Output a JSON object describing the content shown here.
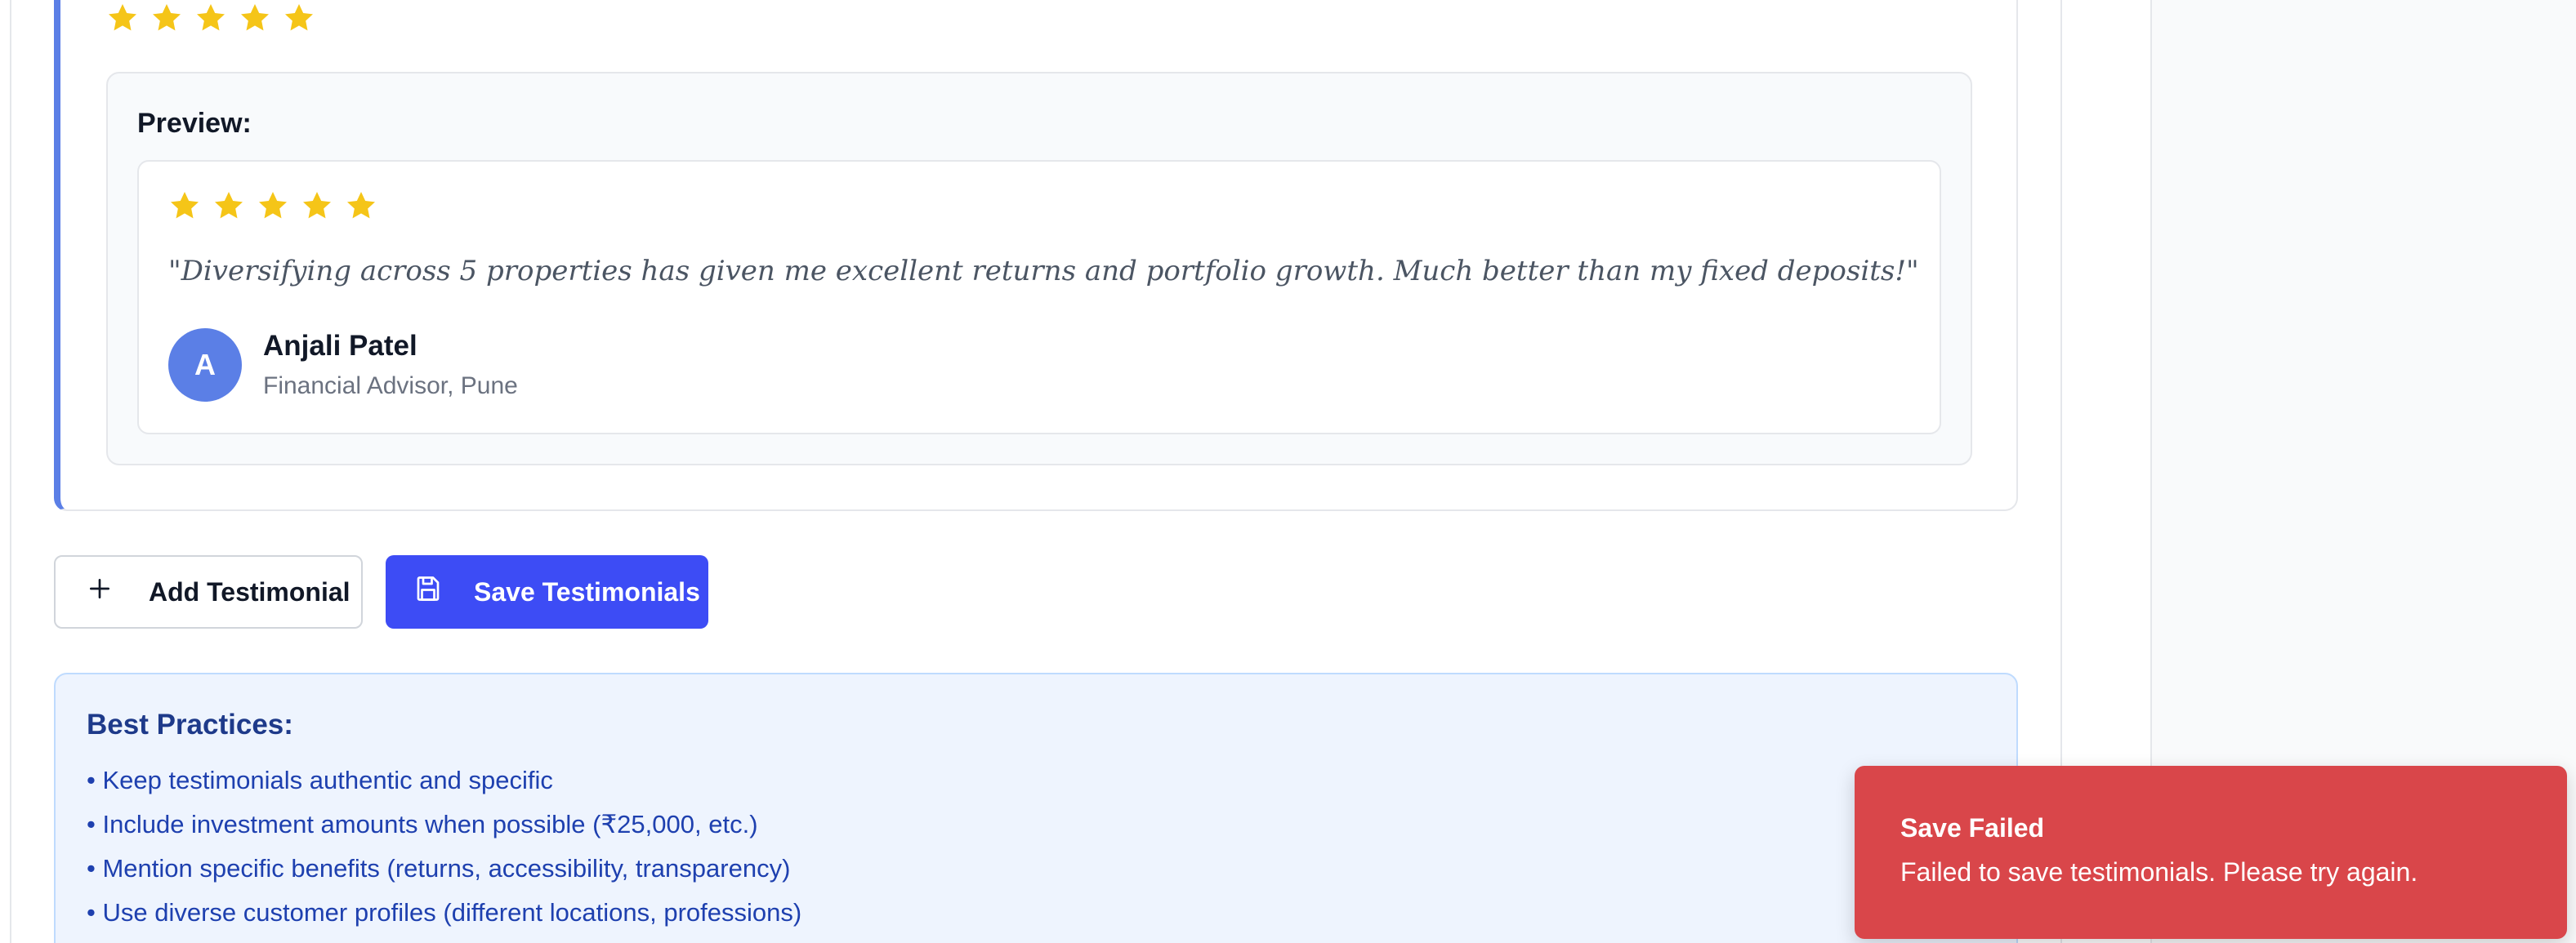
{
  "editor": {
    "rating": 5,
    "star_color": "#f5c518"
  },
  "preview": {
    "label": "Preview:",
    "rating": 5,
    "quote": "\"Diversifying across 5 properties has given me excellent returns and portfolio growth. Much better than my fixed deposits!\"",
    "avatar_initial": "A",
    "author_name": "Anjali Patel",
    "author_role": "Financial Advisor, Pune"
  },
  "actions": {
    "add_label": "Add Testimonial",
    "save_label": "Save Testimonials",
    "add_icon": "plus-icon",
    "save_icon": "save-icon"
  },
  "best_practices": {
    "title": "Best Practices:",
    "items": [
      "• Keep testimonials authentic and specific",
      "• Include investment amounts when possible (₹25,000, etc.)",
      "• Mention specific benefits (returns, accessibility, transparency)",
      "• Use diverse customer profiles (different locations, professions)"
    ]
  },
  "toast": {
    "title": "Save Failed",
    "message": "Failed to save testimonials. Please try again."
  },
  "colors": {
    "accent": "#5b7fe6",
    "primary_button": "#3d4cf5",
    "error": "#d9464a"
  }
}
